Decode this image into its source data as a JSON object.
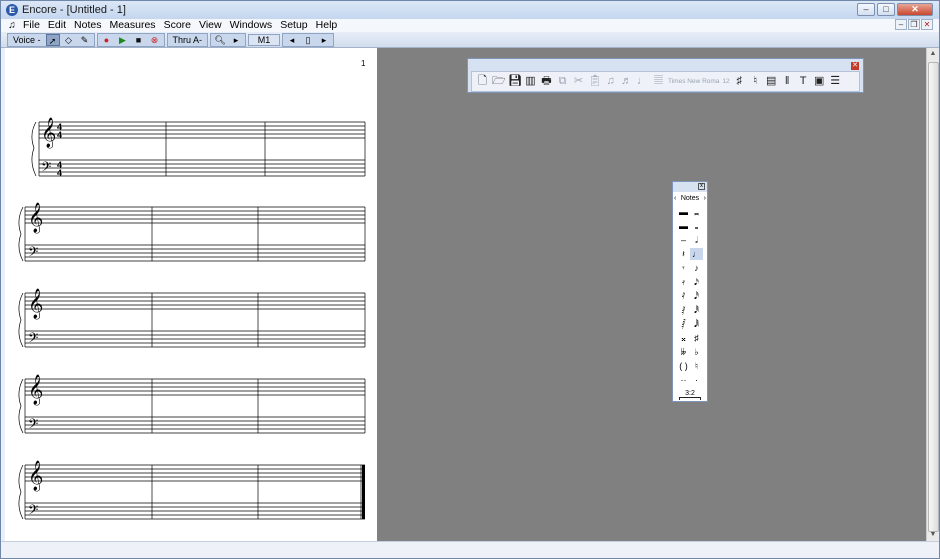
{
  "window": {
    "title": "Encore - [Untitled - 1]"
  },
  "menu": [
    "File",
    "Edit",
    "Notes",
    "Measures",
    "Score",
    "View",
    "Windows",
    "Setup",
    "Help"
  ],
  "toolbar": {
    "voice_label": "Voice -",
    "thru_label": "Thru A-",
    "measure_label": "M1"
  },
  "page": {
    "number": "1"
  },
  "format_toolbar": {
    "font_name": "Times New Roma",
    "font_size": "12"
  },
  "notes_palette": {
    "title": "Notes",
    "tuplet": "3:2"
  },
  "score": {
    "time_signature": [
      "4",
      "4"
    ],
    "systems": 5
  }
}
